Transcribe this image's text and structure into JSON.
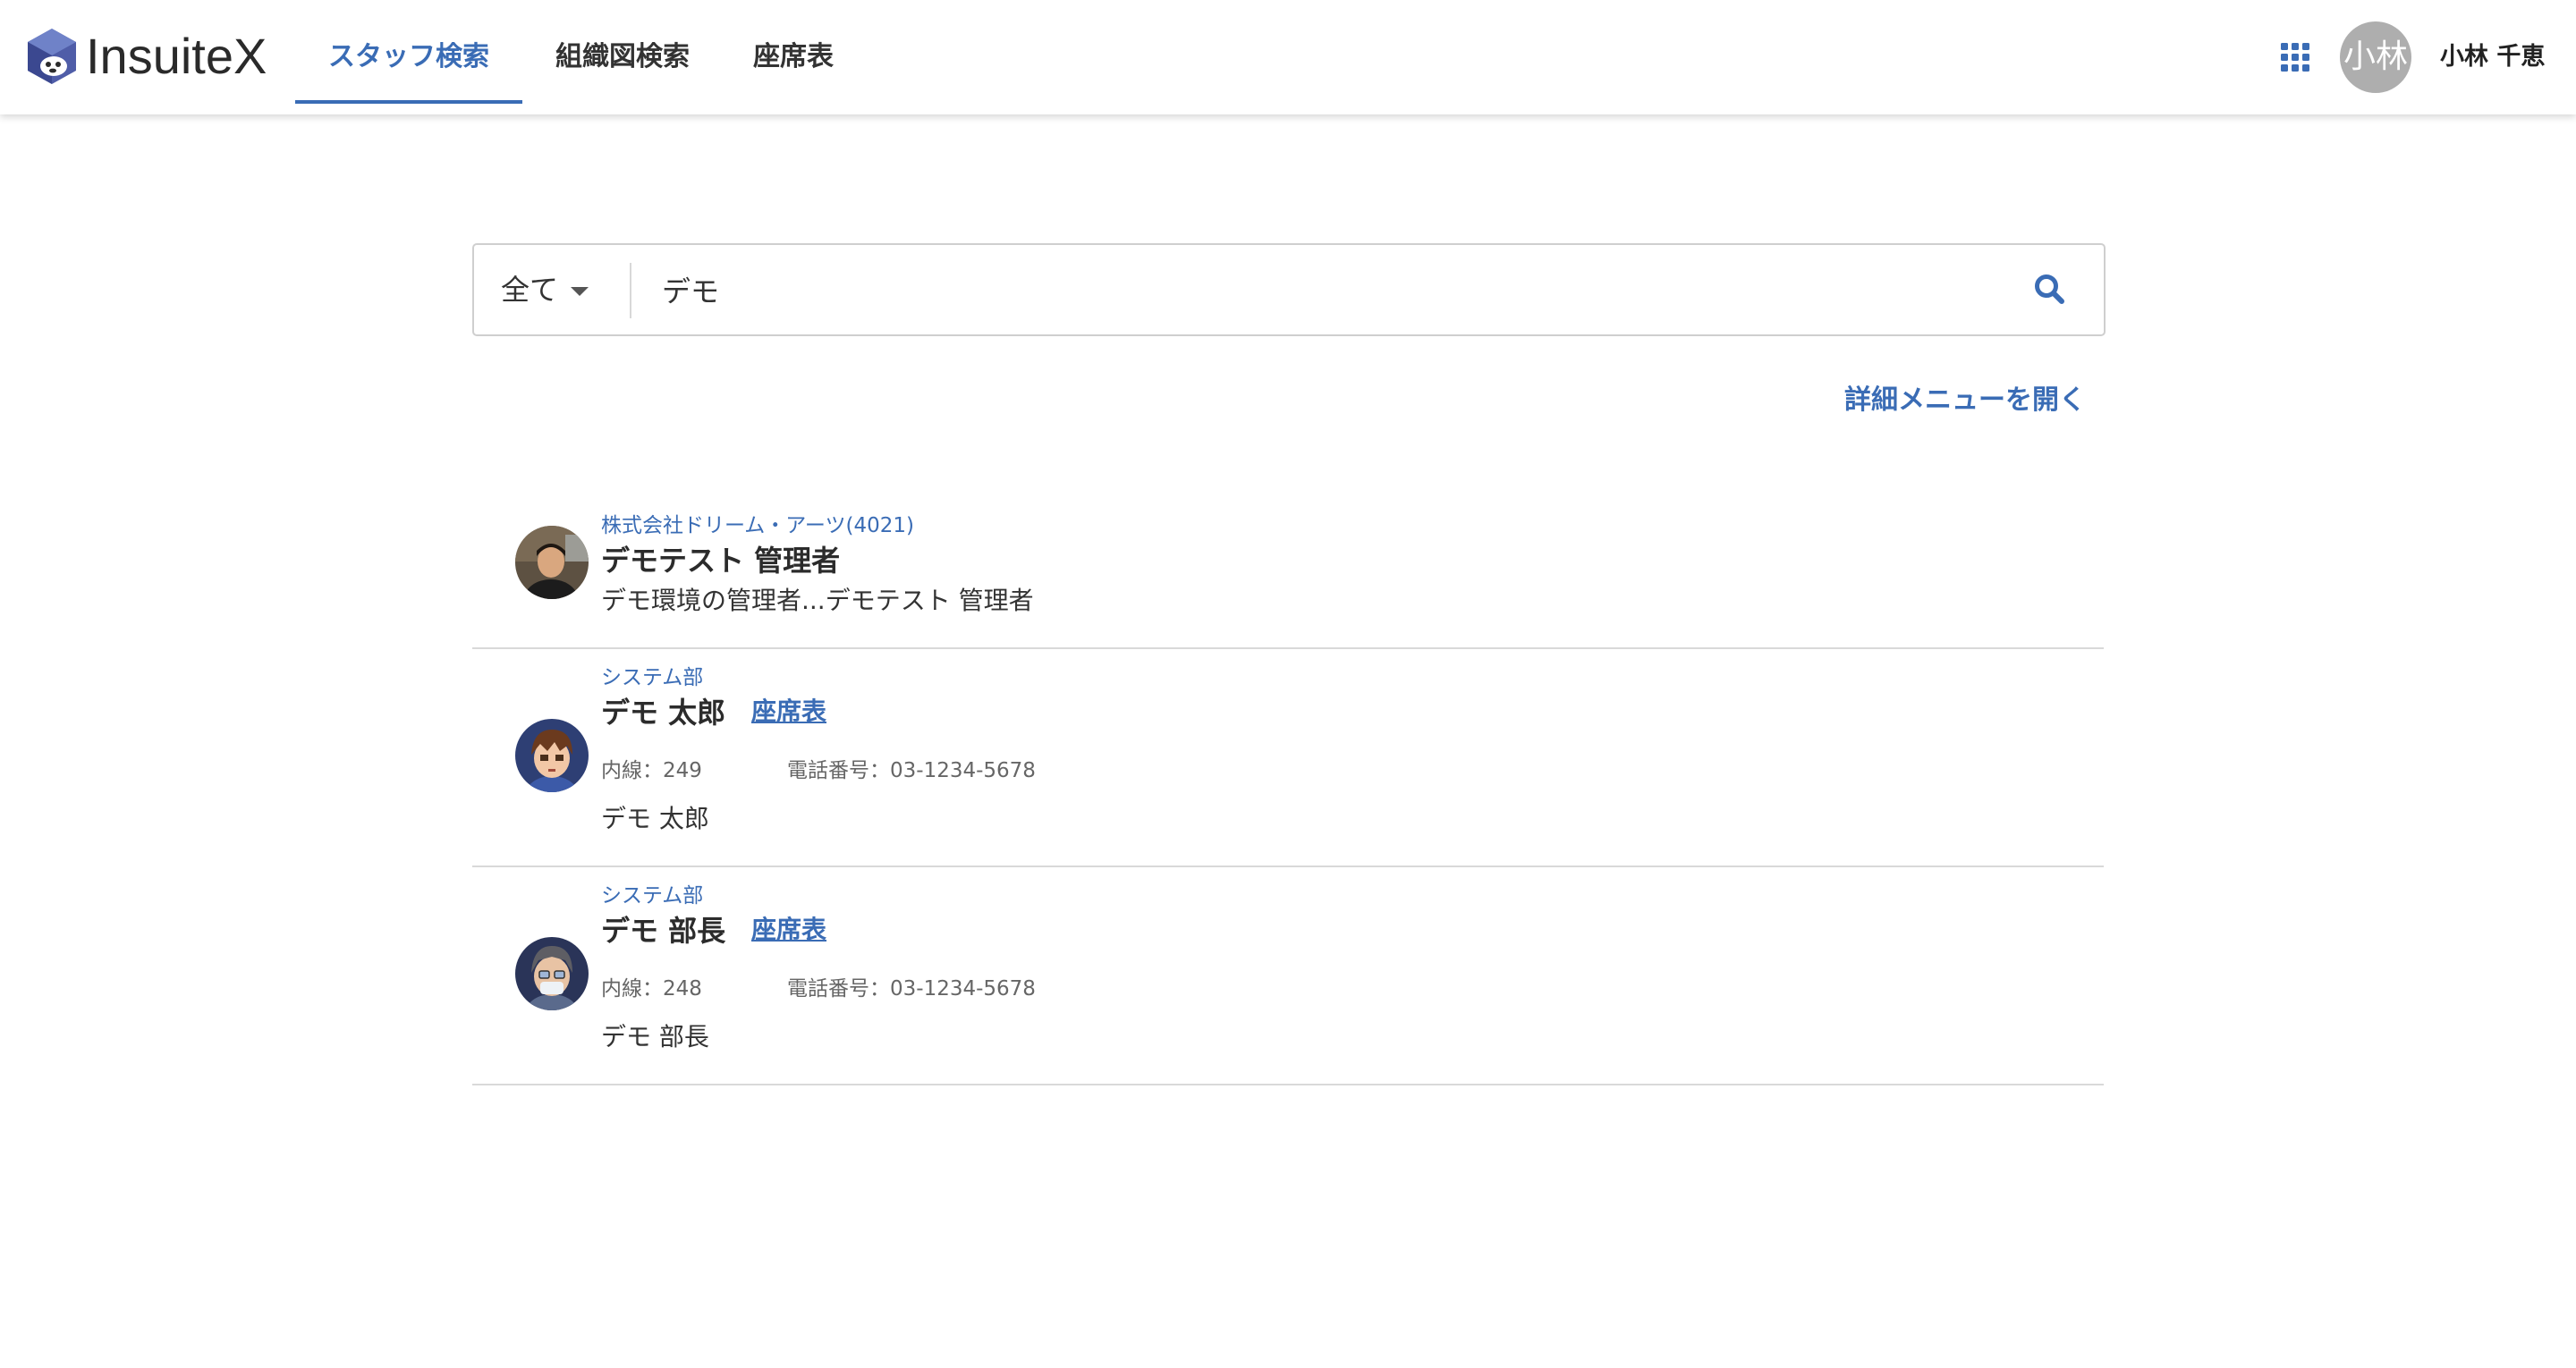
{
  "header": {
    "logo_text": "InsuiteX",
    "nav": [
      {
        "label": "スタッフ検索",
        "active": true
      },
      {
        "label": "組織図検索",
        "active": false
      },
      {
        "label": "座席表",
        "active": false
      }
    ],
    "apps_icon": "grid-apps-icon",
    "user_avatar_text": "小林",
    "user_name": "小林 千恵"
  },
  "search": {
    "scope_label": "全て",
    "query": "デモ",
    "search_icon": "search-icon"
  },
  "detail_menu_label": "詳細メニューを開く",
  "results": [
    {
      "org": "株式会社ドリーム・アーツ(4021)",
      "name": "デモテスト 管理者",
      "description": "デモ環境の管理者...デモテスト 管理者",
      "avatar_icon": "photo-avatar-icon"
    },
    {
      "org": "システム部",
      "name": "デモ 太郎",
      "seat_label": "座席表",
      "extension": "内線：249",
      "phone": "電話番号：03-1234-5678",
      "description": "デモ 太郎",
      "avatar_icon": "anime-boy-avatar-icon"
    },
    {
      "org": "システム部",
      "name": "デモ 部長",
      "seat_label": "座席表",
      "extension": "内線：248",
      "phone": "電話番号：03-1234-5678",
      "description": "デモ 部長",
      "avatar_icon": "masked-avatar-icon"
    }
  ],
  "colors": {
    "accent": "#3a6cb5",
    "divider": "#d9d9d9",
    "avatar_gray": "#aeaeae"
  }
}
